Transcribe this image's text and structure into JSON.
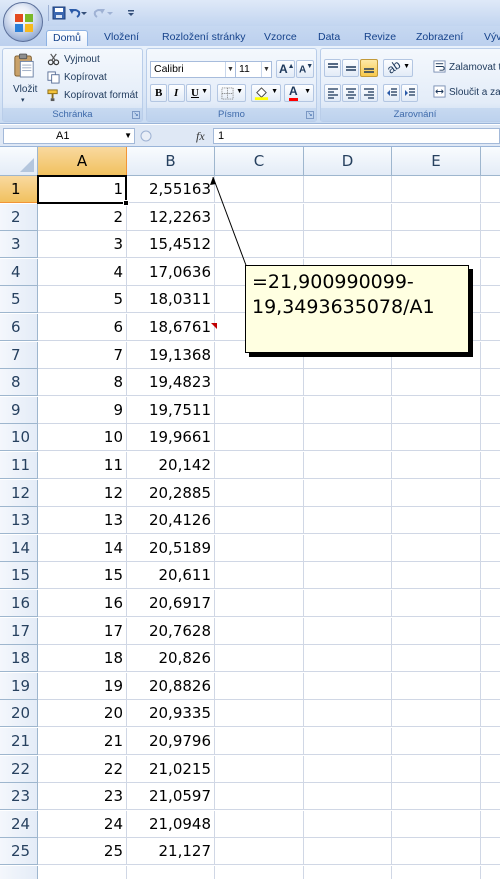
{
  "ribbon_tabs": [
    "Domů",
    "Vložení",
    "Rozložení stránky",
    "Vzorce",
    "Data",
    "Revize",
    "Zobrazení",
    "Výv"
  ],
  "clipboard": {
    "paste_label": "Vložit",
    "cut_label": "Vyjmout",
    "copy_label": "Kopírovat",
    "format_painter_label": "Kopírovat formát",
    "group_label": "Schránka"
  },
  "font": {
    "family": "Calibri",
    "size": "11",
    "group_label": "Písmo",
    "bold_label": "B",
    "italic_label": "I",
    "underline_label": "U"
  },
  "alignment": {
    "wrap_label": "Zalamovat t",
    "merge_label": "Sloučit a za",
    "group_label": "Zarovnání"
  },
  "formula_bar": {
    "name_box": "A1",
    "fx_label": "fx",
    "formula": "1"
  },
  "grid": {
    "columns": [
      "A",
      "B",
      "C",
      "D",
      "E"
    ],
    "rows": [
      {
        "n": "1",
        "a": "1",
        "b": "2,55163"
      },
      {
        "n": "2",
        "a": "2",
        "b": "12,2263"
      },
      {
        "n": "3",
        "a": "3",
        "b": "15,4512"
      },
      {
        "n": "4",
        "a": "4",
        "b": "17,0636"
      },
      {
        "n": "5",
        "a": "5",
        "b": "18,0311"
      },
      {
        "n": "6",
        "a": "6",
        "b": "18,6761"
      },
      {
        "n": "7",
        "a": "7",
        "b": "19,1368"
      },
      {
        "n": "8",
        "a": "8",
        "b": "19,4823"
      },
      {
        "n": "9",
        "a": "9",
        "b": "19,7511"
      },
      {
        "n": "10",
        "a": "10",
        "b": "19,9661"
      },
      {
        "n": "11",
        "a": "11",
        "b": "20,142"
      },
      {
        "n": "12",
        "a": "12",
        "b": "20,2885"
      },
      {
        "n": "13",
        "a": "13",
        "b": "20,4126"
      },
      {
        "n": "14",
        "a": "14",
        "b": "20,5189"
      },
      {
        "n": "15",
        "a": "15",
        "b": "20,611"
      },
      {
        "n": "16",
        "a": "16",
        "b": "20,6917"
      },
      {
        "n": "17",
        "a": "17",
        "b": "20,7628"
      },
      {
        "n": "18",
        "a": "18",
        "b": "20,826"
      },
      {
        "n": "19",
        "a": "19",
        "b": "20,8826"
      },
      {
        "n": "20",
        "a": "20",
        "b": "20,9335"
      },
      {
        "n": "21",
        "a": "21",
        "b": "20,9796"
      },
      {
        "n": "22",
        "a": "22",
        "b": "21,0215"
      },
      {
        "n": "23",
        "a": "23",
        "b": "21,0597"
      },
      {
        "n": "24",
        "a": "24",
        "b": "21,0948"
      },
      {
        "n": "25",
        "a": "25",
        "b": "21,127"
      }
    ]
  },
  "comment": {
    "text": "=21,900990099-\n19,3493635078/A1"
  },
  "colors": {
    "selected_header": "#f1c15f",
    "comment_bg": "#ffffe1",
    "ribbon_text": "#15428b"
  }
}
